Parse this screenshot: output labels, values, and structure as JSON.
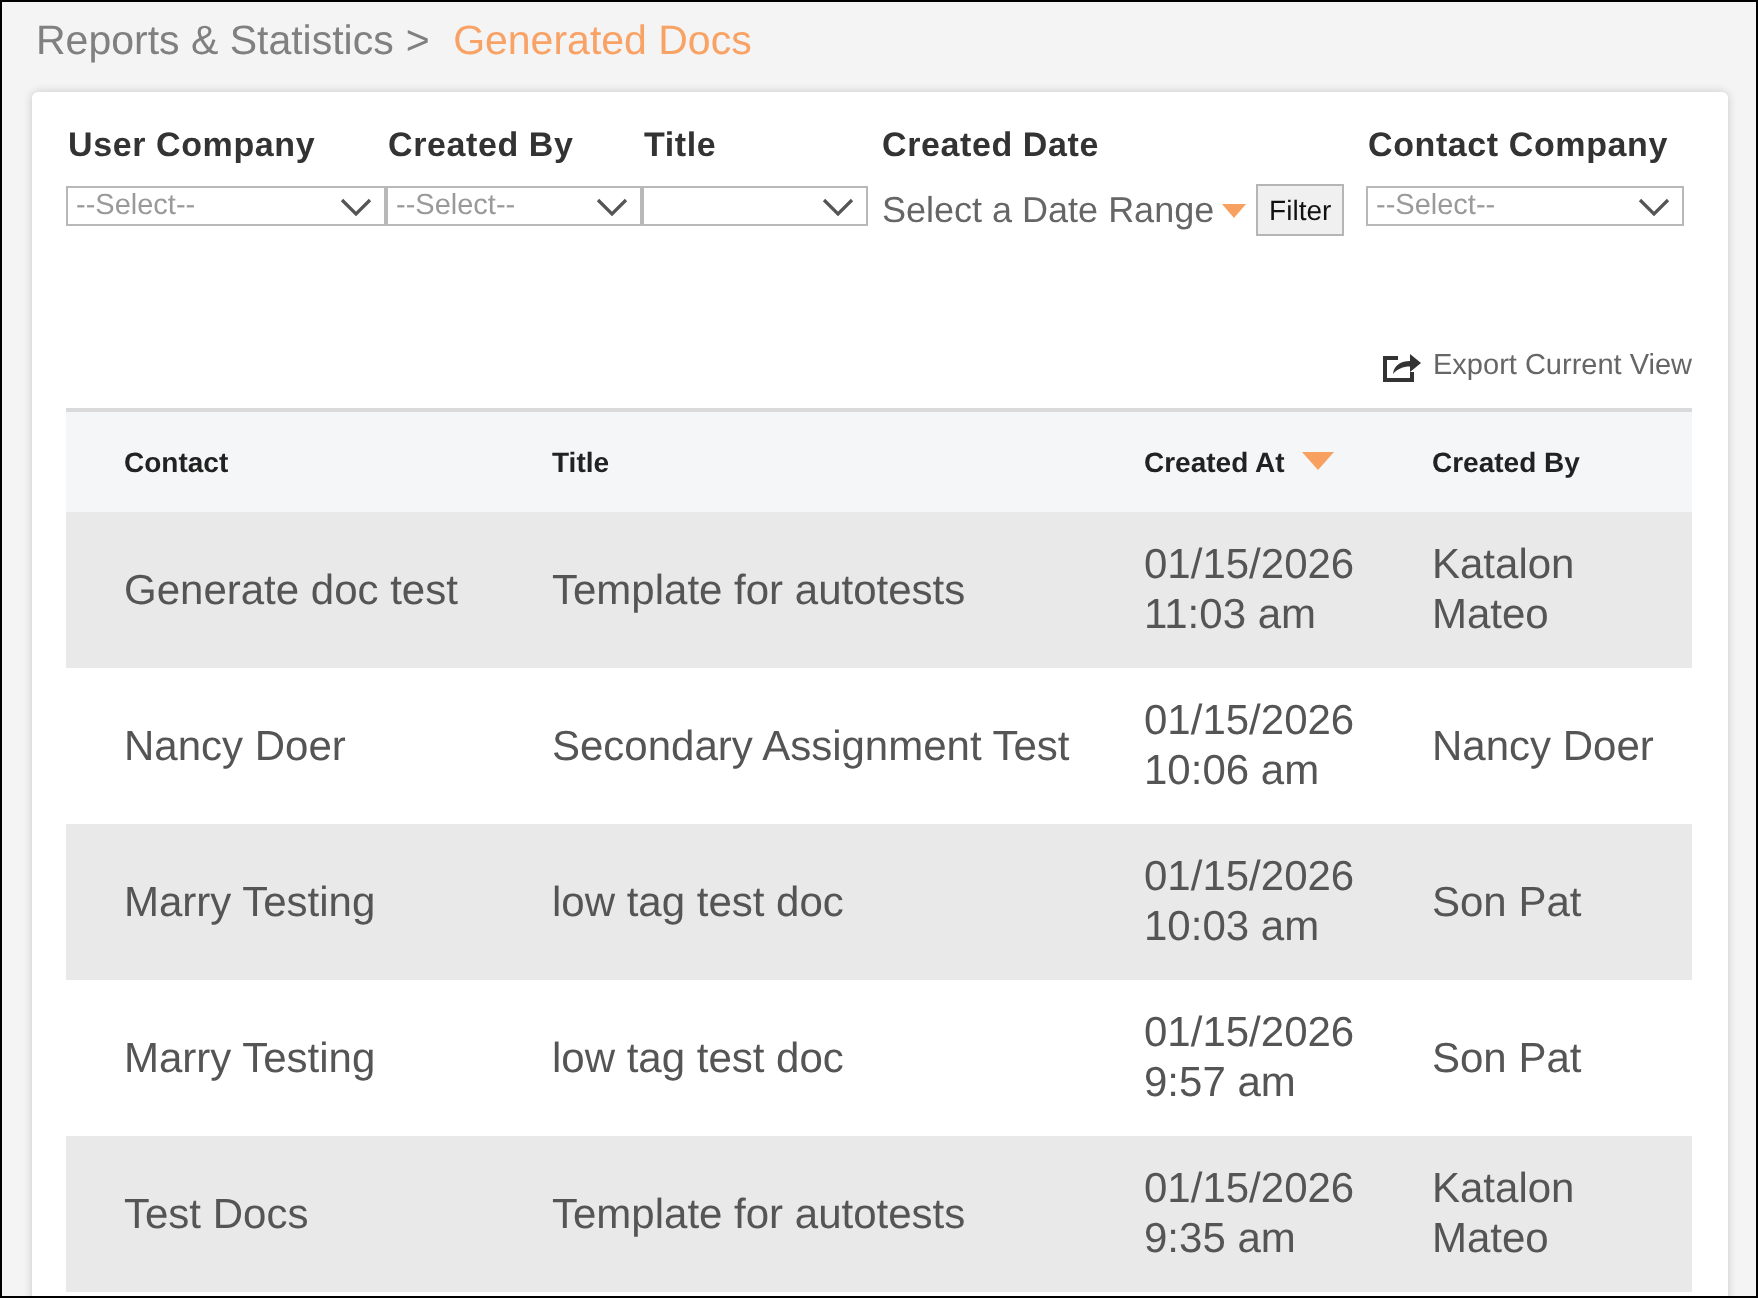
{
  "breadcrumb": {
    "separator": ">",
    "items": [
      {
        "label": "Reports & Statistics",
        "selected": false
      },
      {
        "label": "Generated Docs",
        "selected": true
      }
    ]
  },
  "filters": [
    {
      "kind": "select",
      "label": "User Company",
      "placeholder": "--Select--"
    },
    {
      "kind": "select",
      "label": "Created By",
      "placeholder": "--Select--"
    },
    {
      "kind": "select",
      "label": "Title"
    },
    {
      "kind": "date_range",
      "label": "Created Date",
      "value": "Select a Date Range",
      "button": "Filter"
    },
    {
      "kind": "select",
      "label": "Contact Company",
      "placeholder": "--Select--"
    }
  ],
  "export": {
    "label": "Export Current View"
  },
  "table": {
    "columns": [
      {
        "label": "Contact",
        "sorted": false
      },
      {
        "label": "Title",
        "sorted": false
      },
      {
        "label": "Created At",
        "sorted": true
      },
      {
        "label": "Created By",
        "sorted": false
      }
    ],
    "rows": [
      {
        "cells": [
          "Generate doc test",
          "Template for autotests",
          "01/15/2026 11:03 am",
          "Katalon Mateo"
        ]
      },
      {
        "cells": [
          "Nancy Doer",
          "Secondary Assignment Test",
          "01/15/2026 10:06 am",
          "Nancy Doer"
        ]
      },
      {
        "cells": [
          "Marry Testing",
          "low tag test doc",
          "01/15/2026 10:03 am",
          "Son Pat"
        ]
      },
      {
        "cells": [
          "Marry Testing",
          "low tag test doc",
          "01/15/2026 9:57 am",
          "Son Pat"
        ]
      },
      {
        "cells": [
          "Test Docs",
          "Template for autotests",
          "01/15/2026 9:35 am",
          "Katalon Mateo"
        ]
      }
    ]
  }
}
